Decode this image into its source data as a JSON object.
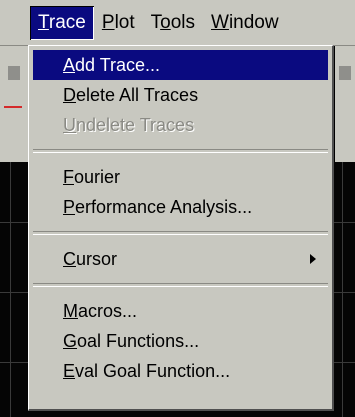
{
  "menubar": {
    "items": [
      {
        "label": "Trace",
        "accel": "T",
        "active": true
      },
      {
        "label": "Plot",
        "accel": "P",
        "active": false
      },
      {
        "label": "Tools",
        "accel": "o",
        "active": false
      },
      {
        "label": "Window",
        "accel": "W",
        "active": false
      }
    ]
  },
  "dropdown": {
    "items": [
      {
        "type": "item",
        "label": "Add Trace...",
        "accel": "A",
        "highlighted": true,
        "disabled": false
      },
      {
        "type": "item",
        "label": "Delete All Traces",
        "accel": "D",
        "highlighted": false,
        "disabled": false
      },
      {
        "type": "item",
        "label": "Undelete Traces",
        "accel": "U",
        "highlighted": false,
        "disabled": true
      },
      {
        "type": "separator"
      },
      {
        "type": "item",
        "label": "Fourier",
        "accel": "F",
        "highlighted": false,
        "disabled": false
      },
      {
        "type": "item",
        "label": "Performance Analysis...",
        "accel": "P",
        "highlighted": false,
        "disabled": false
      },
      {
        "type": "separator"
      },
      {
        "type": "item",
        "label": "Cursor",
        "accel": "C",
        "highlighted": false,
        "disabled": false,
        "submenu": true
      },
      {
        "type": "separator"
      },
      {
        "type": "item",
        "label": "Macros...",
        "accel": "M",
        "highlighted": false,
        "disabled": false
      },
      {
        "type": "item",
        "label": "Goal Functions...",
        "accel": "G",
        "highlighted": false,
        "disabled": false
      },
      {
        "type": "item",
        "label": "Eval Goal Function...",
        "accel": "E",
        "highlighted": false,
        "disabled": false
      }
    ]
  },
  "colors": {
    "menu_bg": "#c8c8c0",
    "highlight": "#0a0a80",
    "disabled_text": "#8a8a84",
    "plot_bg": "#050505",
    "trace_red": "#d42a2a"
  }
}
